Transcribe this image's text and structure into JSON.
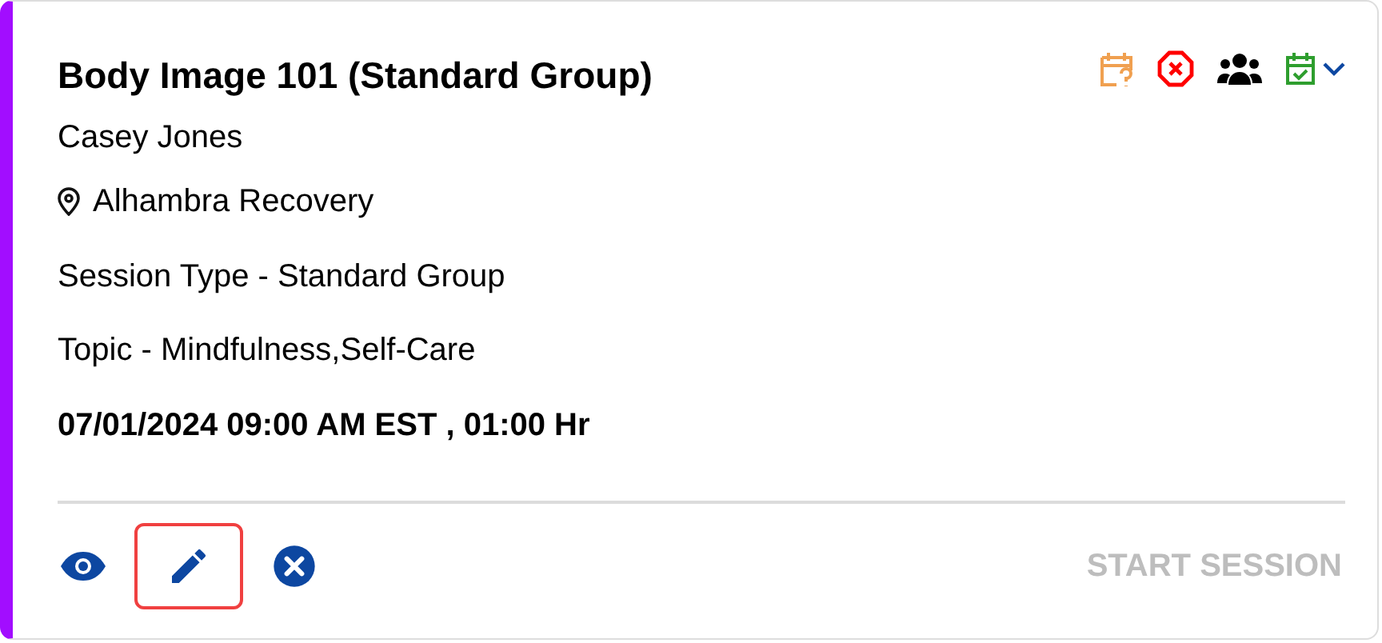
{
  "card": {
    "title": "Body Image 101 (Standard Group)",
    "provider": "Casey Jones",
    "location": "Alhambra Recovery",
    "session_type": "Session Type - Standard Group",
    "topic": "Topic - Mindfulness,Self-Care",
    "schedule": "07/01/2024 09:00 AM EST , 01:00 Hr"
  },
  "status_icons": [
    {
      "kind": "pending",
      "color": "#f0a050"
    },
    {
      "kind": "cancelled",
      "color": "#ff0000"
    },
    {
      "kind": "group",
      "color": "#000000"
    },
    {
      "kind": "scheduled",
      "color": "#2e9e2e"
    }
  ],
  "actions": [
    {
      "kind": "view",
      "focused": false
    },
    {
      "kind": "edit",
      "focused": true
    },
    {
      "kind": "cancel",
      "focused": false
    }
  ],
  "start_button": {
    "label": "START SESSION",
    "disabled": true
  }
}
